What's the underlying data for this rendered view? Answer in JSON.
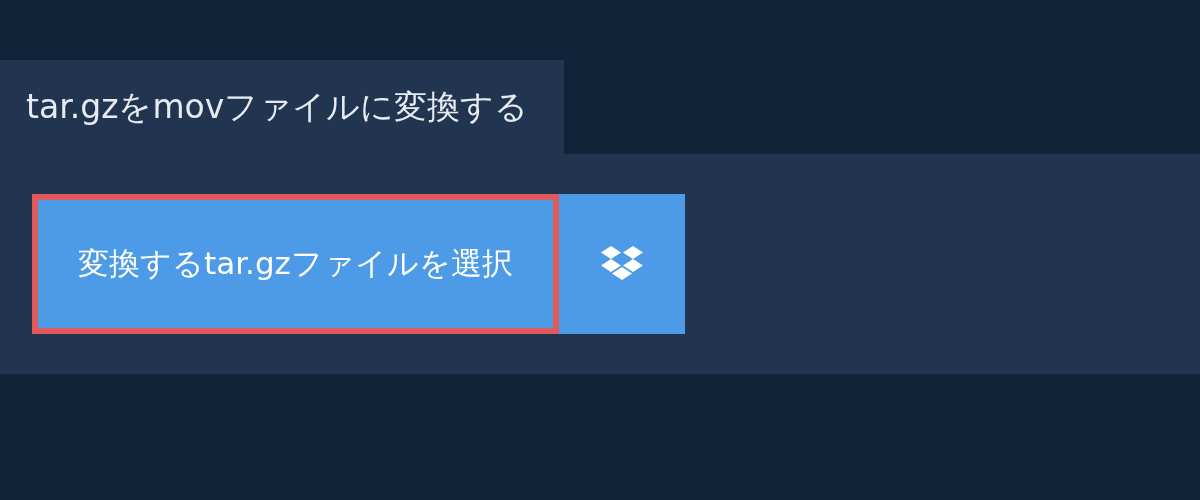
{
  "tab": {
    "label": "tar.gzをmovファイルに変換する",
    "selected": true
  },
  "upload_button": {
    "label": "変換するtar.gzファイルを選択",
    "focused": true
  }
}
